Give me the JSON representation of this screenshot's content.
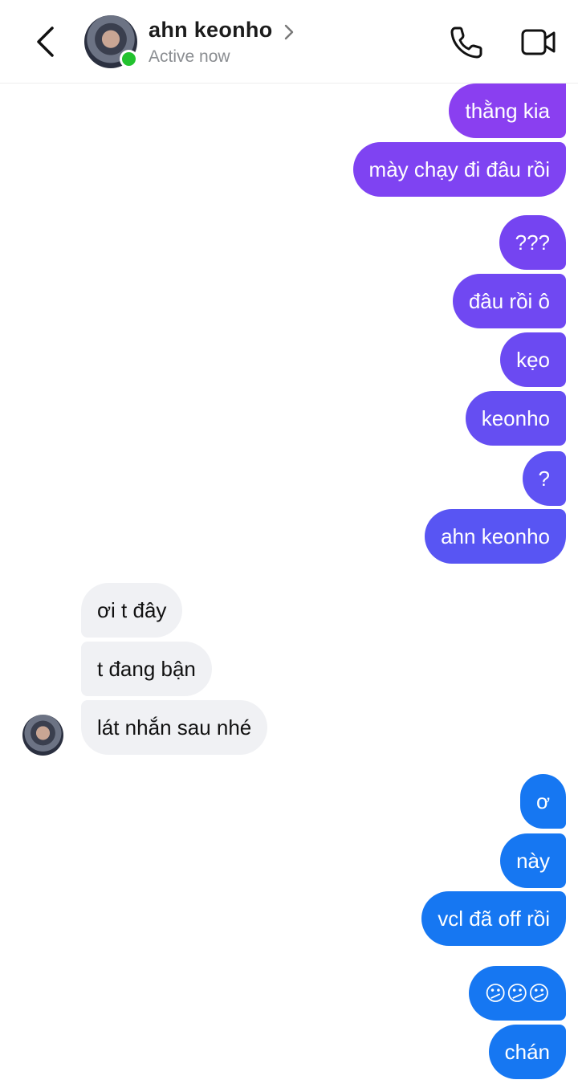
{
  "header": {
    "contact_name": "ahn keonho",
    "status": "Active now"
  },
  "messages": [
    {
      "text": "thằng kia",
      "direction": "outgoing",
      "color": "#8a3ff0"
    },
    {
      "text": "mày chạy đi đâu rồi",
      "direction": "outgoing",
      "color": "#7f43f2"
    },
    {
      "text": "???",
      "direction": "outgoing",
      "color": "#7544f1"
    },
    {
      "text": "đâu rồi ô",
      "direction": "outgoing",
      "color": "#7048f2"
    },
    {
      "text": "kẹo",
      "direction": "outgoing",
      "color": "#6b4af2"
    },
    {
      "text": "keonho",
      "direction": "outgoing",
      "color": "#654ef2"
    },
    {
      "text": "?",
      "direction": "outgoing",
      "color": "#5f52f3"
    },
    {
      "text": "ahn keonho",
      "direction": "outgoing",
      "color": "#5855f3"
    },
    {
      "text": "ơi t đây",
      "direction": "incoming"
    },
    {
      "text": "t đang bận",
      "direction": "incoming"
    },
    {
      "text": "lát nhắn sau nhé",
      "direction": "incoming"
    },
    {
      "text": "ơ",
      "direction": "outgoing",
      "color": "#1677f2"
    },
    {
      "text": "này",
      "direction": "outgoing",
      "color": "#1677f2"
    },
    {
      "text": "vcl đã off rồi",
      "direction": "outgoing",
      "color": "#1677f2"
    },
    {
      "text": "😕😕😕",
      "direction": "outgoing",
      "color": "#1677f2"
    },
    {
      "text": "chán",
      "direction": "outgoing",
      "color": "#1677f2"
    }
  ],
  "colors": {
    "online": "#22c22e",
    "incoming_bubble": "#f0f1f4"
  },
  "icons": [
    "back-arrow-icon",
    "chevron-right-icon",
    "phone-icon",
    "video-camera-icon"
  ]
}
